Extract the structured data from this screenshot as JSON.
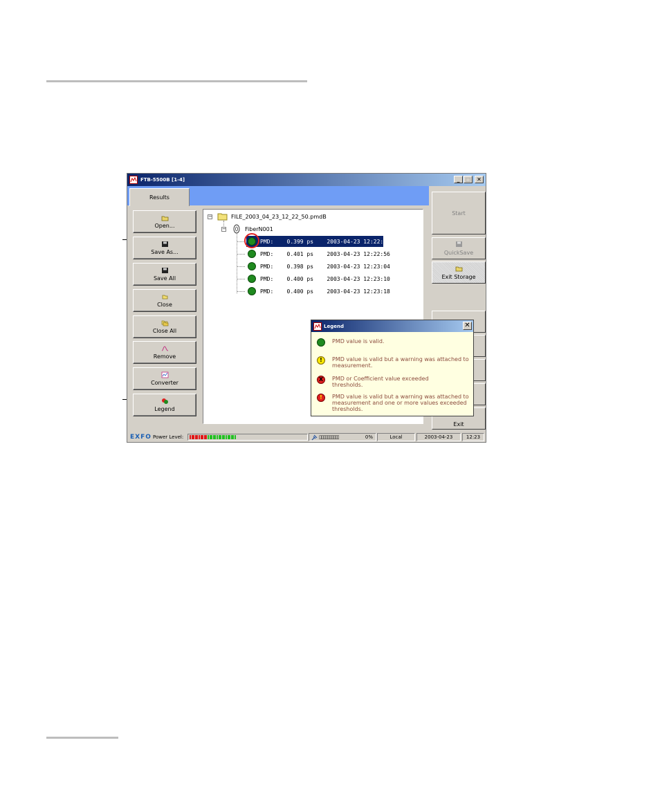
{
  "window": {
    "title": "FTB-5500B [1-4]",
    "minimize": "_",
    "maximize": "□",
    "close": "✕"
  },
  "tabs": {
    "results": "Results"
  },
  "left_buttons": [
    {
      "label": "Open...",
      "icon": "folder-open-icon"
    },
    {
      "label": "Save As...",
      "icon": "floppy-icon"
    },
    {
      "label": "Save All",
      "icon": "floppy-icon"
    },
    {
      "label": "Close",
      "icon": "folder-icon"
    },
    {
      "label": "Close All",
      "icon": "folders-icon"
    },
    {
      "label": "Remove",
      "icon": "curve-icon"
    },
    {
      "label": "Converter",
      "icon": "converter-icon"
    },
    {
      "label": "Legend",
      "icon": "legend-icon"
    }
  ],
  "tree": {
    "file": "FILE_2003_04_23_12_22_50.pmdB",
    "fiber": "FiberN001",
    "rows": [
      {
        "text": "PMD:    0.399 ps    2003-04-23 12:22:50"
      },
      {
        "text": "PMD:    0.401 ps    2003-04-23 12:22:56"
      },
      {
        "text": "PMD:    0.398 ps    2003-04-23 12:23:04"
      },
      {
        "text": "PMD:    0.400 ps    2003-04-23 12:23:10"
      },
      {
        "text": "PMD:    0.400 ps    2003-04-23 12:23:18"
      }
    ]
  },
  "right_buttons": {
    "start": "Start",
    "quicksave": "QuickSave",
    "exit_storage": "Exit Storage",
    "exit": "Exit"
  },
  "statusbar": {
    "brand": "EXFO",
    "power_level_label": "Power Level:",
    "percent": "0%",
    "mode": "Local",
    "date": "2003-04-23",
    "time": "12:23",
    "meter_red_segments": 10,
    "meter_green_segments": 16
  },
  "legend": {
    "title": "Legend",
    "close": "✕",
    "items": [
      {
        "text": "PMD value is valid.",
        "color": "#1f8a1f",
        "symbol": ""
      },
      {
        "text": "PMD value is valid but a warning was attached to measurement.",
        "color": "#f7e600",
        "symbol": "!"
      },
      {
        "text": "PMD or Coefficient value exceeded thresholds.",
        "color": "#e02020",
        "symbol": "X"
      },
      {
        "text": "PMD value is valid but a warning was attached to measurement and one or more values exceeded thresholds.",
        "color": "#e02020",
        "symbol": "!"
      }
    ]
  }
}
